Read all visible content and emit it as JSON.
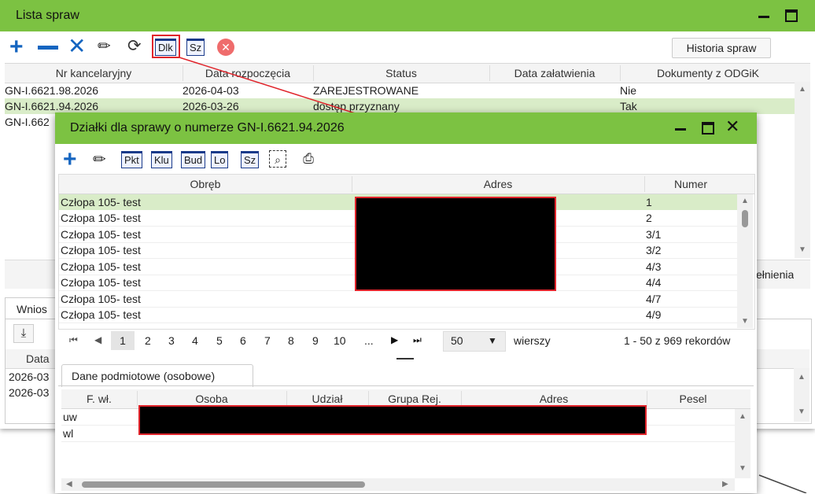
{
  "main": {
    "title": "Lista spraw",
    "history_button": "Historia spraw",
    "toolbar": {
      "dlk": "Dlk",
      "sz": "Sz"
    },
    "columns": [
      "Nr kancelaryjny",
      "Data rozpoczęcia",
      "Status",
      "Data załatwienia",
      "Dokumenty z ODGiK"
    ],
    "rows": [
      {
        "nr": "GN-I.6621.98.2026",
        "date": "2026-04-03",
        "status": "ZAREJESTROWANE",
        "done": "",
        "docs": "Nie"
      },
      {
        "nr": "GN-I.6621.94.2026",
        "date": "2026-03-26",
        "status": "dostęp przyznany",
        "done": "",
        "docs": "Tak"
      },
      {
        "nr": "GN-I.662",
        "date": "",
        "status": "",
        "done": "",
        "docs": ""
      }
    ],
    "partial_header": "ełnienia",
    "lower_tab": "Wnios",
    "lower_col": "Data",
    "lower_rows": [
      "2026-03",
      "2026-03"
    ]
  },
  "dialog": {
    "title": "Działki dla sprawy o numerze GN-I.6621.94.2026",
    "toolbar": {
      "pkt": "Pkt",
      "klu": "Klu",
      "bud": "Bud",
      "lo": "Lo",
      "sz": "Sz"
    },
    "columns": [
      "Obręb",
      "Adres",
      "Numer"
    ],
    "rows": [
      {
        "obreb": "Człopa 105- test",
        "numer": "1"
      },
      {
        "obreb": "Człopa 105- test",
        "numer": "2"
      },
      {
        "obreb": "Człopa 105- test",
        "numer": "3/1"
      },
      {
        "obreb": "Człopa 105- test",
        "numer": "3/2"
      },
      {
        "obreb": "Człopa 105- test",
        "numer": "4/3"
      },
      {
        "obreb": "Człopa 105- test",
        "numer": "4/4"
      },
      {
        "obreb": "Człopa 105- test",
        "numer": "4/7"
      },
      {
        "obreb": "Człopa 105- test",
        "numer": "4/9"
      }
    ],
    "pagination": {
      "pages": [
        "1",
        "2",
        "3",
        "4",
        "5",
        "6",
        "7",
        "8",
        "9",
        "10",
        "..."
      ],
      "per_page": "50",
      "per_page_label": "wierszy",
      "summary": "1 - 50 z 969 rekordów"
    },
    "subtab": "Dane podmiotowe (osobowe)",
    "sub_columns": [
      "F. wł.",
      "Osoba",
      "Udział",
      "Grupa Rej.",
      "Adres",
      "Pesel"
    ],
    "sub_rows": [
      "uw",
      "wl"
    ]
  },
  "colors": {
    "titlebar": "#7cc242",
    "selected_row": "#d9ecc8",
    "accent_blue": "#1565c0",
    "redact_border": "#e0242b"
  }
}
